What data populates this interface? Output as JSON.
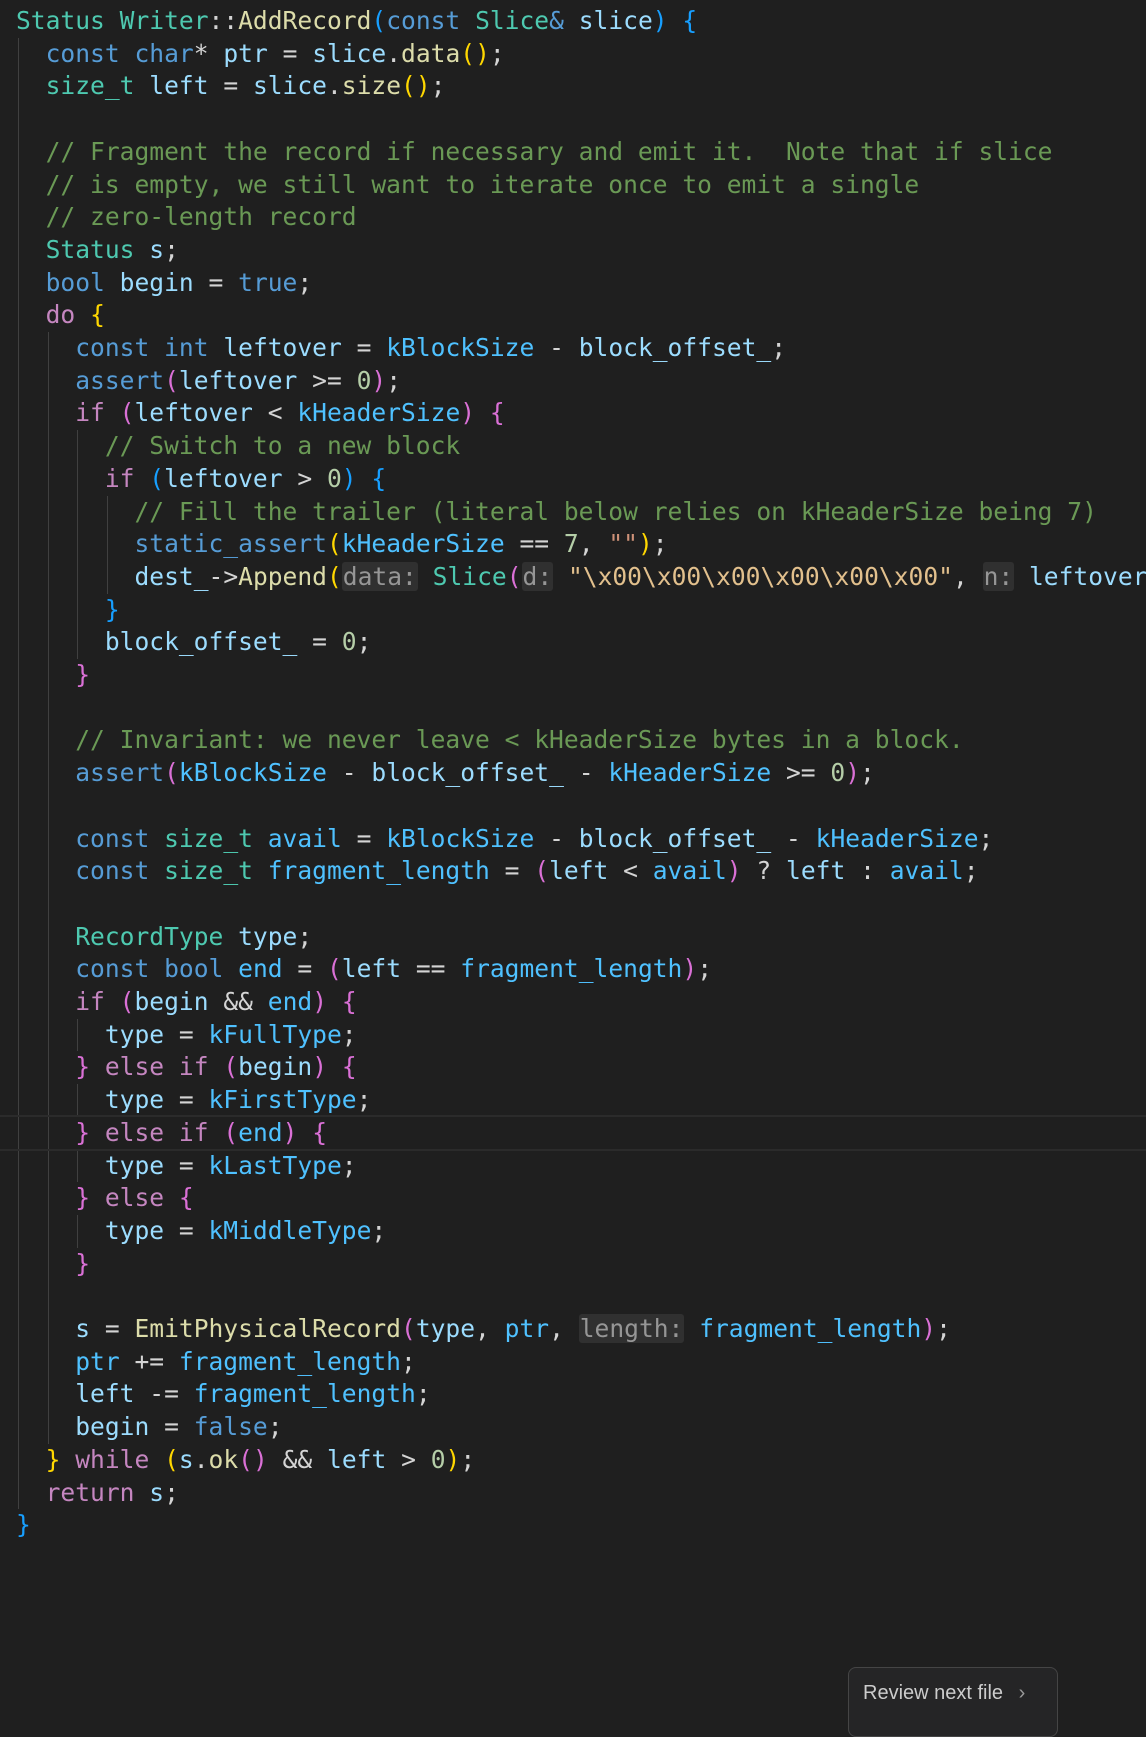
{
  "editor": {
    "language": "cpp",
    "cursor_line": 34,
    "lines": [
      [
        [
          "t-type",
          "Status"
        ],
        [
          "t-plain",
          " "
        ],
        [
          "t-type",
          "Writer"
        ],
        [
          "t-plain",
          "::"
        ],
        [
          "t-fn",
          "AddRecord"
        ],
        [
          "t-b3",
          "("
        ],
        [
          "t-kw",
          "const"
        ],
        [
          "t-plain",
          " "
        ],
        [
          "t-type",
          "Slice"
        ],
        [
          "t-kw",
          "&"
        ],
        [
          "t-plain",
          " "
        ],
        [
          "t-var",
          "slice"
        ],
        [
          "t-b3",
          ")"
        ],
        [
          "t-plain",
          " "
        ],
        [
          "t-b3",
          "{"
        ]
      ],
      [
        [
          "t-plain",
          "  "
        ],
        [
          "t-kw",
          "const"
        ],
        [
          "t-plain",
          " "
        ],
        [
          "t-kw",
          "char"
        ],
        [
          "t-plain",
          "* "
        ],
        [
          "t-var",
          "ptr"
        ],
        [
          "t-plain",
          " = "
        ],
        [
          "t-var",
          "slice"
        ],
        [
          "t-plain",
          "."
        ],
        [
          "t-fn",
          "data"
        ],
        [
          "t-b1",
          "()"
        ],
        [
          "t-plain",
          ";"
        ]
      ],
      [
        [
          "t-plain",
          "  "
        ],
        [
          "t-type",
          "size_t"
        ],
        [
          "t-plain",
          " "
        ],
        [
          "t-var",
          "left"
        ],
        [
          "t-plain",
          " = "
        ],
        [
          "t-var",
          "slice"
        ],
        [
          "t-plain",
          "."
        ],
        [
          "t-fn",
          "size"
        ],
        [
          "t-b1",
          "()"
        ],
        [
          "t-plain",
          ";"
        ]
      ],
      [],
      [
        [
          "t-plain",
          "  "
        ],
        [
          "t-com",
          "// Fragment the record if necessary and emit it.  Note that if slice"
        ]
      ],
      [
        [
          "t-plain",
          "  "
        ],
        [
          "t-com",
          "// is empty, we still want to iterate once to emit a single"
        ]
      ],
      [
        [
          "t-plain",
          "  "
        ],
        [
          "t-com",
          "// zero-length record"
        ]
      ],
      [
        [
          "t-plain",
          "  "
        ],
        [
          "t-type",
          "Status"
        ],
        [
          "t-plain",
          " "
        ],
        [
          "t-var",
          "s"
        ],
        [
          "t-plain",
          ";"
        ]
      ],
      [
        [
          "t-plain",
          "  "
        ],
        [
          "t-kw",
          "bool"
        ],
        [
          "t-plain",
          " "
        ],
        [
          "t-var",
          "begin"
        ],
        [
          "t-plain",
          " = "
        ],
        [
          "t-bool",
          "true"
        ],
        [
          "t-plain",
          ";"
        ]
      ],
      [
        [
          "t-plain",
          "  "
        ],
        [
          "t-ctl",
          "do"
        ],
        [
          "t-plain",
          " "
        ],
        [
          "t-b1",
          "{"
        ]
      ],
      [
        [
          "t-plain",
          "    "
        ],
        [
          "t-kw",
          "const"
        ],
        [
          "t-plain",
          " "
        ],
        [
          "t-kw",
          "int"
        ],
        [
          "t-plain",
          " "
        ],
        [
          "t-var",
          "leftover"
        ],
        [
          "t-plain",
          " = "
        ],
        [
          "t-const",
          "kBlockSize"
        ],
        [
          "t-plain",
          " - "
        ],
        [
          "t-var",
          "block_offset_"
        ],
        [
          "t-plain",
          ";"
        ]
      ],
      [
        [
          "t-plain",
          "    "
        ],
        [
          "t-kw",
          "assert"
        ],
        [
          "t-b2",
          "("
        ],
        [
          "t-var",
          "leftover"
        ],
        [
          "t-plain",
          " >= "
        ],
        [
          "t-num",
          "0"
        ],
        [
          "t-b2",
          ")"
        ],
        [
          "t-plain",
          ";"
        ]
      ],
      [
        [
          "t-plain",
          "    "
        ],
        [
          "t-ctl",
          "if"
        ],
        [
          "t-plain",
          " "
        ],
        [
          "t-b2",
          "("
        ],
        [
          "t-var",
          "leftover"
        ],
        [
          "t-plain",
          " < "
        ],
        [
          "t-const",
          "kHeaderSize"
        ],
        [
          "t-b2",
          ")"
        ],
        [
          "t-plain",
          " "
        ],
        [
          "t-b2",
          "{"
        ]
      ],
      [
        [
          "t-plain",
          "      "
        ],
        [
          "t-com",
          "// Switch to a new block"
        ]
      ],
      [
        [
          "t-plain",
          "      "
        ],
        [
          "t-ctl",
          "if"
        ],
        [
          "t-plain",
          " "
        ],
        [
          "t-b3",
          "("
        ],
        [
          "t-var",
          "leftover"
        ],
        [
          "t-plain",
          " > "
        ],
        [
          "t-num",
          "0"
        ],
        [
          "t-b3",
          ")"
        ],
        [
          "t-plain",
          " "
        ],
        [
          "t-b3",
          "{"
        ]
      ],
      [
        [
          "t-plain",
          "        "
        ],
        [
          "t-com",
          "// Fill the trailer (literal below relies on kHeaderSize being 7)"
        ]
      ],
      [
        [
          "t-plain",
          "        "
        ],
        [
          "t-kw",
          "static_assert"
        ],
        [
          "t-b1",
          "("
        ],
        [
          "t-const",
          "kHeaderSize"
        ],
        [
          "t-plain",
          " == "
        ],
        [
          "t-num",
          "7"
        ],
        [
          "t-plain",
          ", "
        ],
        [
          "t-str",
          "\"\""
        ],
        [
          "t-b1",
          ")"
        ],
        [
          "t-plain",
          ";"
        ]
      ],
      [
        [
          "t-plain",
          "        "
        ],
        [
          "t-var",
          "dest_"
        ],
        [
          "t-plain",
          "->"
        ],
        [
          "t-fn",
          "Append"
        ],
        [
          "t-b1",
          "("
        ],
        [
          "t-hint",
          "data:"
        ],
        [
          "t-plain",
          " "
        ],
        [
          "t-type",
          "Slice"
        ],
        [
          "t-b2",
          "("
        ],
        [
          "t-hint",
          "d:"
        ],
        [
          "t-plain",
          " "
        ],
        [
          "t-strw",
          "\"\\x00\\x00\\x00\\x00\\x00\\x00\""
        ],
        [
          "t-plain",
          ", "
        ],
        [
          "t-hint",
          "n:"
        ],
        [
          "t-plain",
          " "
        ],
        [
          "t-var",
          "leftover"
        ],
        [
          "t-b2",
          ")"
        ],
        [
          "t-b1",
          ")"
        ],
        [
          "t-plain",
          ";"
        ]
      ],
      [
        [
          "t-plain",
          "      "
        ],
        [
          "t-b3",
          "}"
        ]
      ],
      [
        [
          "t-plain",
          "      "
        ],
        [
          "t-var",
          "block_offset_"
        ],
        [
          "t-plain",
          " = "
        ],
        [
          "t-num",
          "0"
        ],
        [
          "t-plain",
          ";"
        ]
      ],
      [
        [
          "t-plain",
          "    "
        ],
        [
          "t-b2",
          "}"
        ]
      ],
      [],
      [
        [
          "t-plain",
          "    "
        ],
        [
          "t-com",
          "// Invariant: we never leave < kHeaderSize bytes in a block."
        ]
      ],
      [
        [
          "t-plain",
          "    "
        ],
        [
          "t-kw",
          "assert"
        ],
        [
          "t-b2",
          "("
        ],
        [
          "t-const",
          "kBlockSize"
        ],
        [
          "t-plain",
          " - "
        ],
        [
          "t-var",
          "block_offset_"
        ],
        [
          "t-plain",
          " - "
        ],
        [
          "t-const",
          "kHeaderSize"
        ],
        [
          "t-plain",
          " >= "
        ],
        [
          "t-num",
          "0"
        ],
        [
          "t-b2",
          ")"
        ],
        [
          "t-plain",
          ";"
        ]
      ],
      [],
      [
        [
          "t-plain",
          "    "
        ],
        [
          "t-kw",
          "const"
        ],
        [
          "t-plain",
          " "
        ],
        [
          "t-type",
          "size_t"
        ],
        [
          "t-plain",
          " "
        ],
        [
          "t-const",
          "avail"
        ],
        [
          "t-plain",
          " = "
        ],
        [
          "t-const",
          "kBlockSize"
        ],
        [
          "t-plain",
          " - "
        ],
        [
          "t-var",
          "block_offset_"
        ],
        [
          "t-plain",
          " - "
        ],
        [
          "t-const",
          "kHeaderSize"
        ],
        [
          "t-plain",
          ";"
        ]
      ],
      [
        [
          "t-plain",
          "    "
        ],
        [
          "t-kw",
          "const"
        ],
        [
          "t-plain",
          " "
        ],
        [
          "t-type",
          "size_t"
        ],
        [
          "t-plain",
          " "
        ],
        [
          "t-const",
          "fragment_length"
        ],
        [
          "t-plain",
          " = "
        ],
        [
          "t-b2",
          "("
        ],
        [
          "t-var",
          "left"
        ],
        [
          "t-plain",
          " < "
        ],
        [
          "t-const",
          "avail"
        ],
        [
          "t-b2",
          ")"
        ],
        [
          "t-plain",
          " ? "
        ],
        [
          "t-var",
          "left"
        ],
        [
          "t-plain",
          " : "
        ],
        [
          "t-const",
          "avail"
        ],
        [
          "t-plain",
          ";"
        ]
      ],
      [],
      [
        [
          "t-plain",
          "    "
        ],
        [
          "t-type",
          "RecordType"
        ],
        [
          "t-plain",
          " "
        ],
        [
          "t-var",
          "type"
        ],
        [
          "t-plain",
          ";"
        ]
      ],
      [
        [
          "t-plain",
          "    "
        ],
        [
          "t-kw",
          "const"
        ],
        [
          "t-plain",
          " "
        ],
        [
          "t-kw",
          "bool"
        ],
        [
          "t-plain",
          " "
        ],
        [
          "t-const",
          "end"
        ],
        [
          "t-plain",
          " = "
        ],
        [
          "t-b2",
          "("
        ],
        [
          "t-var",
          "left"
        ],
        [
          "t-plain",
          " == "
        ],
        [
          "t-const",
          "fragment_length"
        ],
        [
          "t-b2",
          ")"
        ],
        [
          "t-plain",
          ";"
        ]
      ],
      [
        [
          "t-plain",
          "    "
        ],
        [
          "t-ctl",
          "if"
        ],
        [
          "t-plain",
          " "
        ],
        [
          "t-b2",
          "("
        ],
        [
          "t-var",
          "begin"
        ],
        [
          "t-plain",
          " && "
        ],
        [
          "t-const",
          "end"
        ],
        [
          "t-b2",
          ")"
        ],
        [
          "t-plain",
          " "
        ],
        [
          "t-b2",
          "{"
        ]
      ],
      [
        [
          "t-plain",
          "      "
        ],
        [
          "t-var",
          "type"
        ],
        [
          "t-plain",
          " = "
        ],
        [
          "t-const",
          "kFullType"
        ],
        [
          "t-plain",
          ";"
        ]
      ],
      [
        [
          "t-plain",
          "    "
        ],
        [
          "t-b2",
          "}"
        ],
        [
          "t-plain",
          " "
        ],
        [
          "t-ctl",
          "else"
        ],
        [
          "t-plain",
          " "
        ],
        [
          "t-ctl",
          "if"
        ],
        [
          "t-plain",
          " "
        ],
        [
          "t-b2",
          "("
        ],
        [
          "t-var",
          "begin"
        ],
        [
          "t-b2",
          ")"
        ],
        [
          "t-plain",
          " "
        ],
        [
          "t-b2",
          "{"
        ]
      ],
      [
        [
          "t-plain",
          "      "
        ],
        [
          "t-var",
          "type"
        ],
        [
          "t-plain",
          " = "
        ],
        [
          "t-const",
          "kFirstType"
        ],
        [
          "t-plain",
          ";"
        ]
      ],
      [
        [
          "t-plain",
          "    "
        ],
        [
          "t-b2",
          "}"
        ],
        [
          "t-plain",
          " "
        ],
        [
          "t-ctl",
          "else"
        ],
        [
          "t-plain",
          " "
        ],
        [
          "t-ctl",
          "if"
        ],
        [
          "t-plain",
          " "
        ],
        [
          "t-b2",
          "("
        ],
        [
          "t-const",
          "end"
        ],
        [
          "t-b2",
          ")"
        ],
        [
          "t-plain",
          " "
        ],
        [
          "t-b2",
          "{"
        ]
      ],
      [
        [
          "t-plain",
          "      "
        ],
        [
          "t-var",
          "type"
        ],
        [
          "t-plain",
          " = "
        ],
        [
          "t-const",
          "kLastType"
        ],
        [
          "t-plain",
          ";"
        ]
      ],
      [
        [
          "t-plain",
          "    "
        ],
        [
          "t-b2",
          "}"
        ],
        [
          "t-plain",
          " "
        ],
        [
          "t-ctl",
          "else"
        ],
        [
          "t-plain",
          " "
        ],
        [
          "t-b2",
          "{"
        ]
      ],
      [
        [
          "t-plain",
          "      "
        ],
        [
          "t-var",
          "type"
        ],
        [
          "t-plain",
          " = "
        ],
        [
          "t-const",
          "kMiddleType"
        ],
        [
          "t-plain",
          ";"
        ]
      ],
      [
        [
          "t-plain",
          "    "
        ],
        [
          "t-b2",
          "}"
        ]
      ],
      [],
      [
        [
          "t-plain",
          "    "
        ],
        [
          "t-var",
          "s"
        ],
        [
          "t-plain",
          " = "
        ],
        [
          "t-fn",
          "EmitPhysicalRecord"
        ],
        [
          "t-b2",
          "("
        ],
        [
          "t-var",
          "type"
        ],
        [
          "t-plain",
          ", "
        ],
        [
          "t-const",
          "ptr"
        ],
        [
          "t-plain",
          ", "
        ],
        [
          "t-hint",
          "length:"
        ],
        [
          "t-plain",
          " "
        ],
        [
          "t-const",
          "fragment_length"
        ],
        [
          "t-b2",
          ")"
        ],
        [
          "t-plain",
          ";"
        ]
      ],
      [
        [
          "t-plain",
          "    "
        ],
        [
          "t-const",
          "ptr"
        ],
        [
          "t-plain",
          " += "
        ],
        [
          "t-const",
          "fragment_length"
        ],
        [
          "t-plain",
          ";"
        ]
      ],
      [
        [
          "t-plain",
          "    "
        ],
        [
          "t-var",
          "left"
        ],
        [
          "t-plain",
          " -= "
        ],
        [
          "t-const",
          "fragment_length"
        ],
        [
          "t-plain",
          ";"
        ]
      ],
      [
        [
          "t-plain",
          "    "
        ],
        [
          "t-var",
          "begin"
        ],
        [
          "t-plain",
          " = "
        ],
        [
          "t-bool",
          "false"
        ],
        [
          "t-plain",
          ";"
        ]
      ],
      [
        [
          "t-plain",
          "  "
        ],
        [
          "t-b1",
          "}"
        ],
        [
          "t-plain",
          " "
        ],
        [
          "t-ctl",
          "while"
        ],
        [
          "t-plain",
          " "
        ],
        [
          "t-b1",
          "("
        ],
        [
          "t-var",
          "s"
        ],
        [
          "t-plain",
          "."
        ],
        [
          "t-fn",
          "ok"
        ],
        [
          "t-b2",
          "()"
        ],
        [
          "t-plain",
          " && "
        ],
        [
          "t-var",
          "left"
        ],
        [
          "t-plain",
          " > "
        ],
        [
          "t-num",
          "0"
        ],
        [
          "t-b1",
          ")"
        ],
        [
          "t-plain",
          ";"
        ]
      ],
      [
        [
          "t-plain",
          "  "
        ],
        [
          "t-ctl",
          "return"
        ],
        [
          "t-plain",
          " "
        ],
        [
          "t-var",
          "s"
        ],
        [
          "t-plain",
          ";"
        ]
      ],
      [
        [
          "t-b3",
          "}"
        ]
      ]
    ]
  },
  "review_button": {
    "label": "Review next file",
    "icon": "chevron-right-icon",
    "chevron_glyph": "›"
  },
  "colors": {
    "background": "#1f1f1f",
    "comment": "#6a9955",
    "keyword": "#569cd6",
    "control": "#c586c0",
    "type": "#4ec9b0",
    "function": "#dcdcaa",
    "variable": "#9cdcfe",
    "number": "#b5cea8",
    "string": "#ce9178"
  }
}
